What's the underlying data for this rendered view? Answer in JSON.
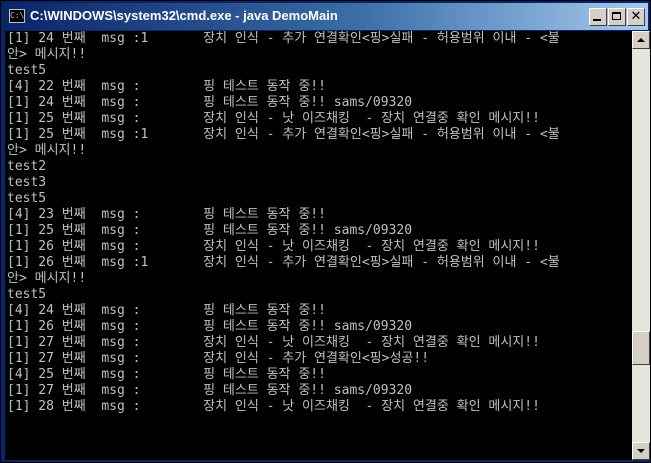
{
  "window": {
    "title": "C:\\WINDOWS\\system32\\cmd.exe - java DemoMain",
    "icon_label": "C:\\",
    "colors": {
      "background": "#000000",
      "text": "#c0c0c0",
      "titlebar": "#0a246a"
    }
  },
  "console": {
    "lines": [
      "[1] 24 번째  msg :1       장치 인식 - 추가 연결확인<핑>실패 - 허용범위 이내 - <불",
      "안> 메시지!!",
      "test5",
      "[4] 22 번째  msg :        핑 테스트 동작 중!!",
      "[1] 24 번째  msg :        핑 테스트 동작 중!! sams/09320",
      "[1] 25 번째  msg :        장치 인식 - 낫 이즈채킹  - 장치 연결중 확인 메시지!!",
      "[1] 25 번째  msg :1       장치 인식 - 추가 연결확인<핑>실패 - 허용범위 이내 - <불",
      "안> 메시지!!",
      "test2",
      "test3",
      "test5",
      "[4] 23 번째  msg :        핑 테스트 동작 중!!",
      "[1] 25 번째  msg :        핑 테스트 동작 중!! sams/09320",
      "[1] 26 번째  msg :        장치 인식 - 낫 이즈채킹  - 장치 연결중 확인 메시지!!",
      "[1] 26 번째  msg :1       장치 인식 - 추가 연결확인<핑>실패 - 허용범위 이내 - <불",
      "안> 메시지!!",
      "test5",
      "[4] 24 번째  msg :        핑 테스트 동작 중!!",
      "[1] 26 번째  msg :        핑 테스트 동작 중!! sams/09320",
      "[1] 27 번째  msg :        장치 인식 - 낫 이즈채킹  - 장치 연결중 확인 메시지!!",
      "[1] 27 번째  msg :        장치 인식 - 추가 연결확인<핑>성공!!",
      "[4] 25 번째  msg :        핑 테스트 동작 중!!",
      "[1] 27 번째  msg :        핑 테스트 동작 중!! sams/09320",
      "[1] 28 번째  msg :        장치 인식 - 낫 이즈채킹  - 장치 연결중 확인 메시지!!"
    ]
  }
}
